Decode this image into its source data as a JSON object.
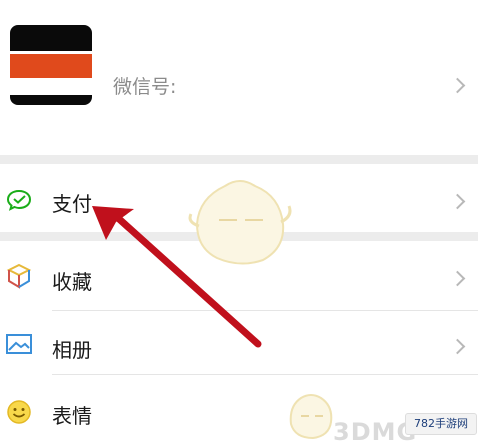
{
  "profile": {
    "wechat_id_label": "微信号:"
  },
  "menu": {
    "items": [
      {
        "label": "支付",
        "icon": "wechat-pay-icon"
      },
      {
        "label": "收藏",
        "icon": "favorites-cube-icon"
      },
      {
        "label": "相册",
        "icon": "album-icon"
      },
      {
        "label": "表情",
        "icon": "sticker-smile-icon"
      }
    ]
  },
  "overlay": {
    "arrow_color": "#c0101c",
    "watermark_text": "3DMG",
    "watermark_badge": "782手游网"
  },
  "colors": {
    "accent_green": "#1aad19",
    "avatar_orange": "#e04a1c",
    "gap_gray": "#ececec"
  }
}
